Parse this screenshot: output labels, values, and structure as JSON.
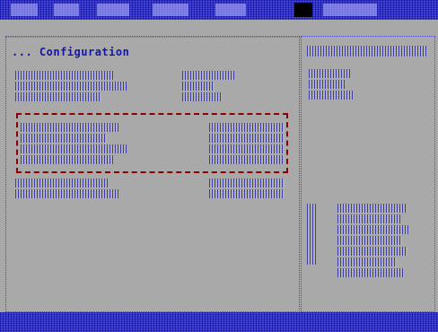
{
  "header": {
    "title": "",
    "items": [
      "",
      "",
      "",
      "",
      "",
      ""
    ]
  },
  "page": {
    "title": "... Configuration"
  },
  "sidebar": {
    "items": [
      "",
      "",
      ""
    ],
    "help_lines": [
      "",
      "",
      "",
      "",
      "",
      "",
      ""
    ]
  },
  "footer": {
    "items": [
      "",
      "",
      "",
      "",
      ""
    ]
  },
  "colors": {
    "background": "#a8a8a8",
    "text": "#1515a8",
    "bar": "#2a2ab8",
    "selection_border": "#8b0000"
  }
}
